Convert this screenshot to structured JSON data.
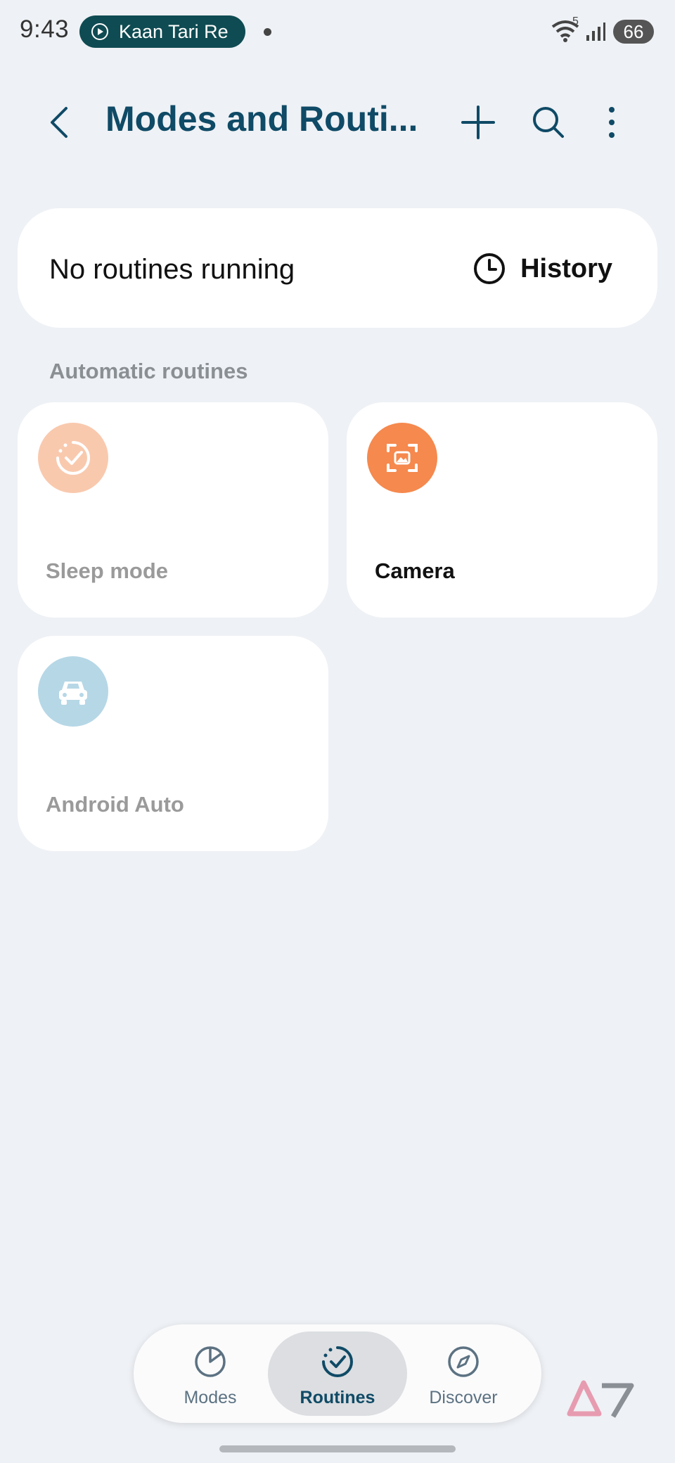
{
  "status_bar": {
    "time": "9:43",
    "media_title": "Kaan Tari Re",
    "wifi_label": "5",
    "battery": "66"
  },
  "app_bar": {
    "title": "Modes and Routi..."
  },
  "running": {
    "status_text": "No routines running",
    "history_label": "History"
  },
  "section": {
    "automatic_routines": "Automatic routines"
  },
  "routines": [
    {
      "label": "Sleep mode",
      "icon": "sleep-routine-icon",
      "color": "#f9c9ae",
      "enabled": false
    },
    {
      "label": "Camera",
      "icon": "camera-routine-icon",
      "color": "#f5894e",
      "enabled": true
    },
    {
      "label": "Android Auto",
      "icon": "car-icon",
      "color": "#b6d7e6",
      "enabled": false
    }
  ],
  "bottom_nav": {
    "items": [
      {
        "label": "Modes",
        "icon": "modes-icon"
      },
      {
        "label": "Routines",
        "icon": "routines-icon",
        "selected": true
      },
      {
        "label": "Discover",
        "icon": "compass-icon"
      }
    ]
  },
  "colors": {
    "accent": "#0f4a66",
    "background": "#eef1f5",
    "media_pill": "#0f4b52"
  }
}
